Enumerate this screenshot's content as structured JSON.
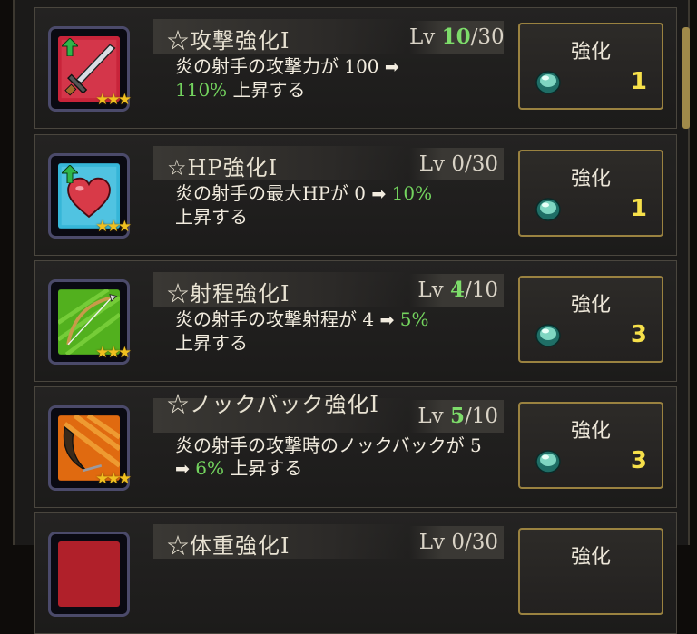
{
  "skills": [
    {
      "title": "☆攻撃強化I",
      "level_label": "Lv",
      "level_current": "10",
      "level_sep": "/",
      "level_max": "30",
      "desc_text": "炎の射手の攻撃力が 100 ",
      "arrow": "➡",
      "desc_before_green": "",
      "desc_green": "110%",
      "desc_after": " 上昇する",
      "button_label": "強化",
      "cost": "1",
      "stars": "★★★",
      "icon": "sword-icon",
      "current_highlight": true
    },
    {
      "title": "☆HP強化I",
      "level_label": "Lv",
      "level_current": "0",
      "level_sep": "/",
      "level_max": "30",
      "desc_text": "炎の射手の最大HPが 0 ",
      "arrow": "➡",
      "desc_green": "10%",
      "desc_after": "上昇する",
      "button_label": "強化",
      "cost": "1",
      "stars": "★★★",
      "icon": "heart-icon",
      "current_highlight": false
    },
    {
      "title": "☆射程強化I",
      "level_label": "Lv",
      "level_current": "4",
      "level_sep": "/",
      "level_max": "10",
      "desc_text": "炎の射手の攻撃射程が 4 ",
      "arrow": "➡",
      "desc_green": "5%",
      "desc_after": "上昇する",
      "button_label": "強化",
      "cost": "3",
      "stars": "★★★",
      "icon": "bow-icon",
      "current_highlight": true
    },
    {
      "title": "☆ノックバック強化I",
      "level_label": "Lv",
      "level_current": "5",
      "level_sep": "/",
      "level_max": "10",
      "desc_text": "炎の射手の攻撃時のノックバックが 5 ",
      "arrow": "➡",
      "desc_green": "6%",
      "desc_after": " 上昇する",
      "button_label": "強化",
      "cost": "3",
      "stars": "★★★",
      "icon": "scythe-icon",
      "current_highlight": true
    },
    {
      "title": "☆体重強化I",
      "level_label": "Lv",
      "level_current": "0",
      "level_sep": "/",
      "level_max": "30",
      "button_label": "強化",
      "icon": "weight-icon",
      "current_highlight": false
    }
  ]
}
